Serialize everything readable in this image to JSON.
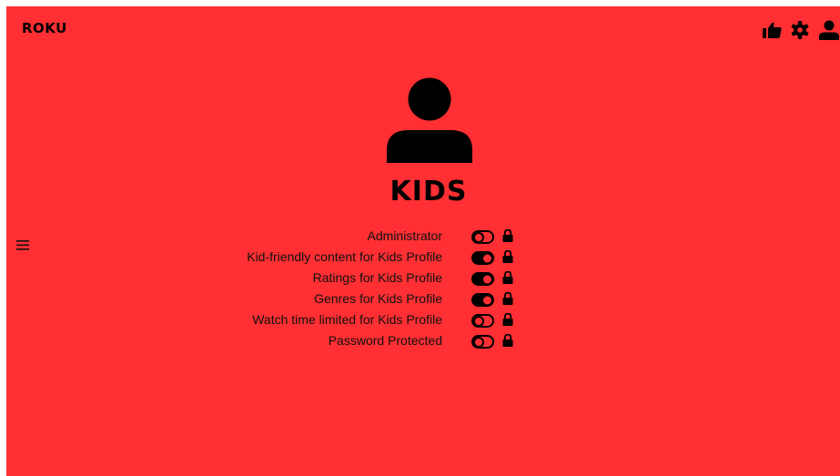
{
  "app": {
    "brand": "ROKU"
  },
  "header": {
    "icons": [
      "thumbs-up-icon",
      "gear-icon",
      "user-icon"
    ]
  },
  "profile": {
    "name": "KIDS",
    "avatar_icon": "user-icon"
  },
  "settings": [
    {
      "label": "Administrator",
      "toggle": "off",
      "locked": true
    },
    {
      "label": "Kid-friendly content for Kids Profile",
      "toggle": "on",
      "locked": true
    },
    {
      "label": "Ratings for Kids Profile",
      "toggle": "on",
      "locked": true
    },
    {
      "label": "Genres for Kids Profile",
      "toggle": "on",
      "locked": true
    },
    {
      "label": "Watch time limited for Kids Profile",
      "toggle": "off",
      "locked": true
    },
    {
      "label": "Password Protected",
      "toggle": "off",
      "locked": true
    }
  ],
  "colors": {
    "background": "#ff2f33",
    "foreground": "#000000"
  }
}
